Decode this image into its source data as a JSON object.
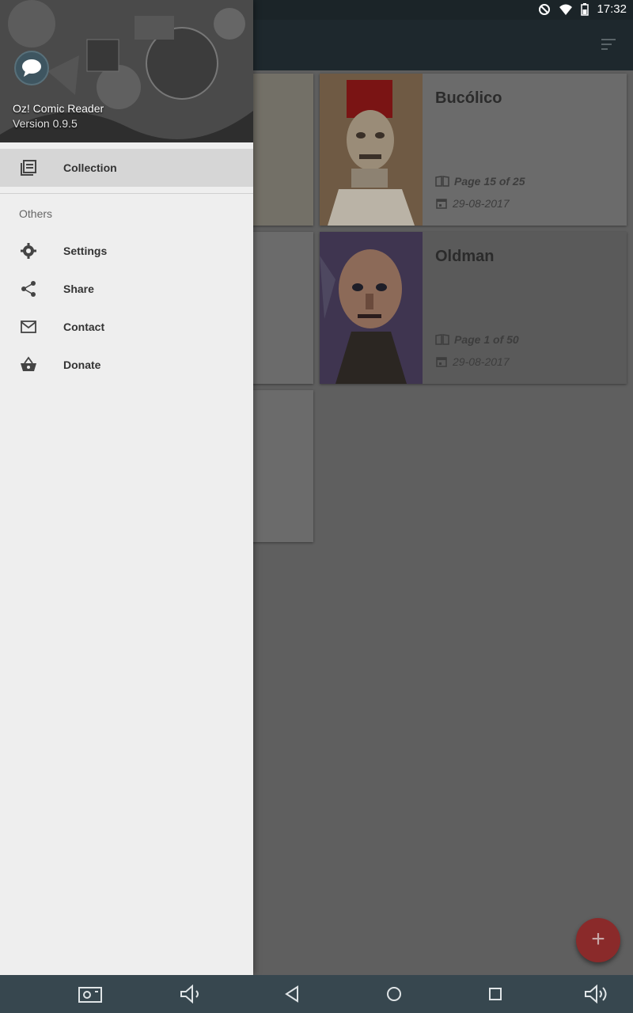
{
  "status_bar": {
    "time": "17:32"
  },
  "drawer": {
    "app_name": "Oz! Comic Reader",
    "version": "Version 0.9.5",
    "active_item": {
      "label": "Collection",
      "icon": "collection-icon"
    },
    "section_label": "Others",
    "items": [
      {
        "label": "Settings",
        "icon": "settings-icon"
      },
      {
        "label": "Share",
        "icon": "share-icon"
      },
      {
        "label": "Contact",
        "icon": "mail-icon"
      },
      {
        "label": "Donate",
        "icon": "basket-icon"
      }
    ]
  },
  "comics": [
    {
      "title": "Bucólico",
      "page": "Page 15 of 25",
      "date": "29-08-2017"
    },
    {
      "title": "Oldman",
      "page": "Page 1 of 50",
      "date": "29-08-2017"
    }
  ],
  "fab": {
    "label": "+"
  },
  "colors": {
    "accent": "#c62828",
    "toolbar": "#263238",
    "drawer_bg": "#eeeeee"
  }
}
